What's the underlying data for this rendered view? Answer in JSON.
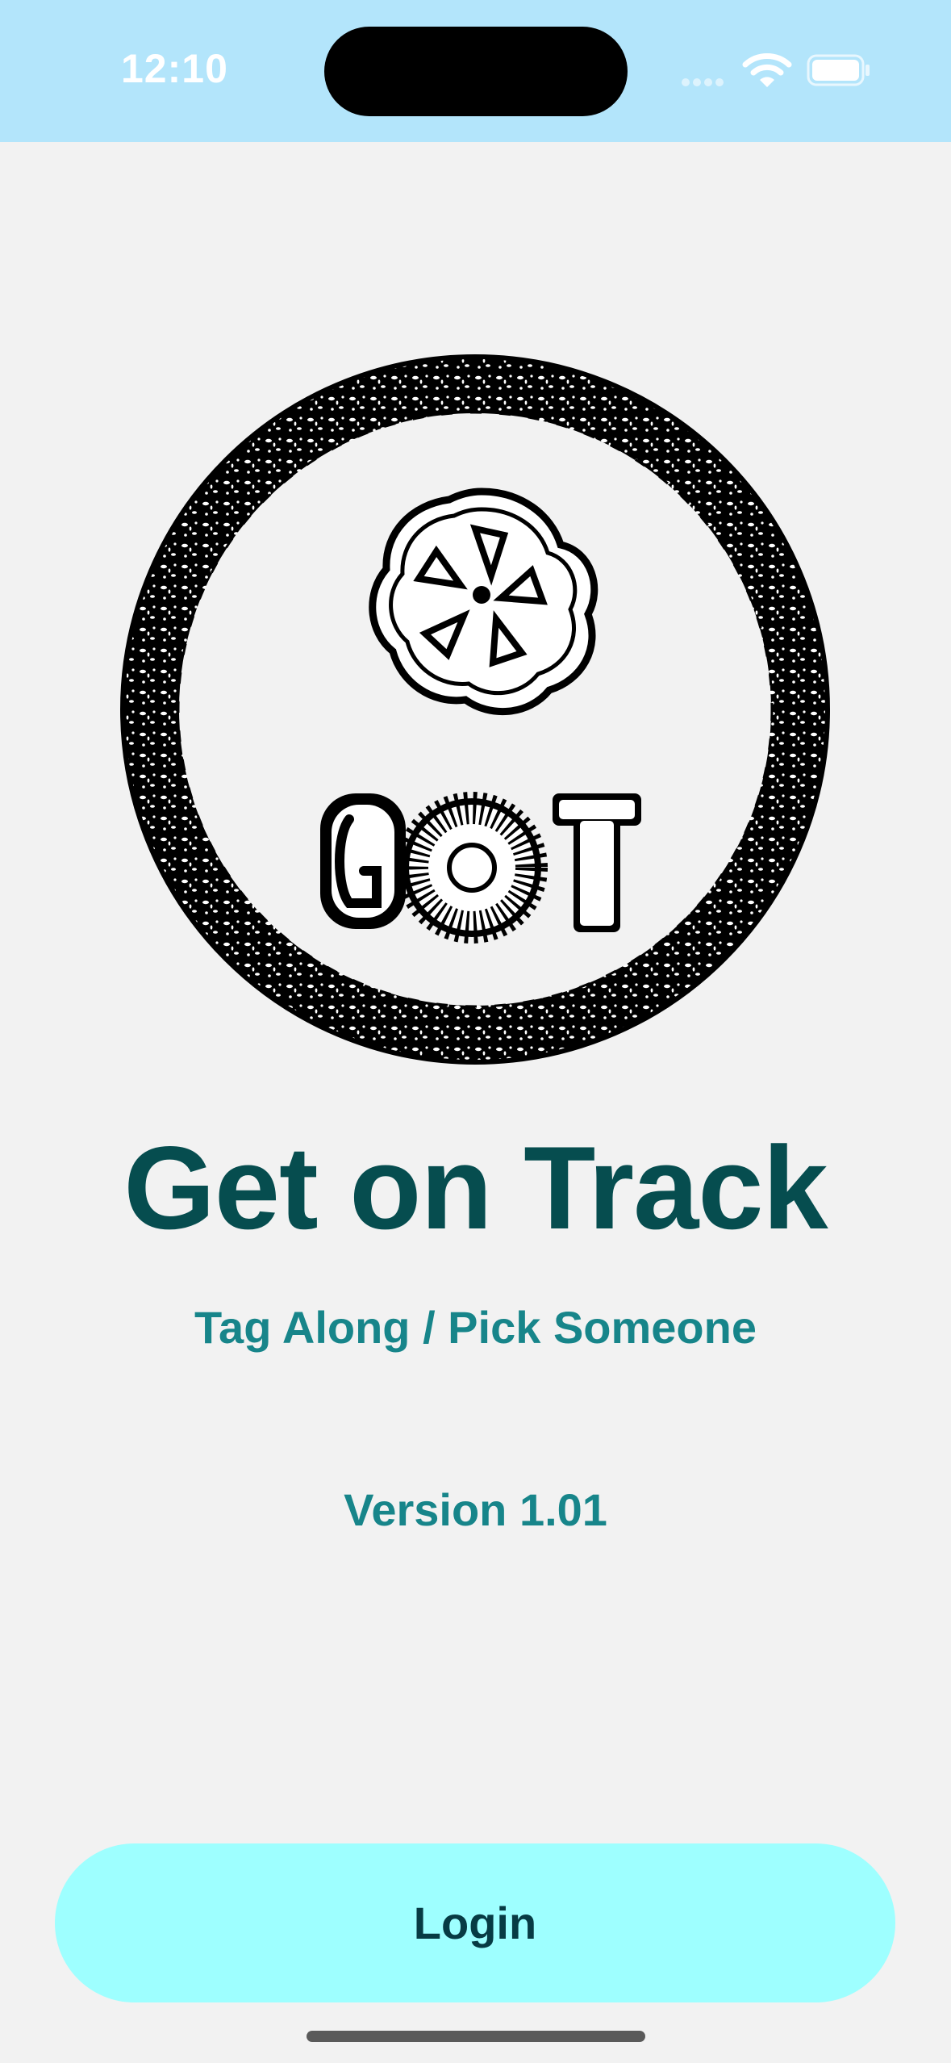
{
  "status_bar": {
    "time": "12:10",
    "icons": [
      "cellular-signal-icon",
      "wifi-icon",
      "battery-icon"
    ]
  },
  "logo": {
    "icon": "got-logo-icon",
    "letters": [
      "G",
      "T"
    ]
  },
  "header": {
    "title": "Get on Track",
    "subtitle": "Tag Along / Pick Someone"
  },
  "version": {
    "label": "Version 1.01"
  },
  "actions": {
    "login_label": "Login"
  },
  "colors": {
    "status_bar_bg": "#b3e5fb",
    "page_bg": "#f2f2f2",
    "title": "#064d4f",
    "accent_text": "#17858a",
    "button_bg": "#9effff",
    "button_text": "#073b44"
  }
}
